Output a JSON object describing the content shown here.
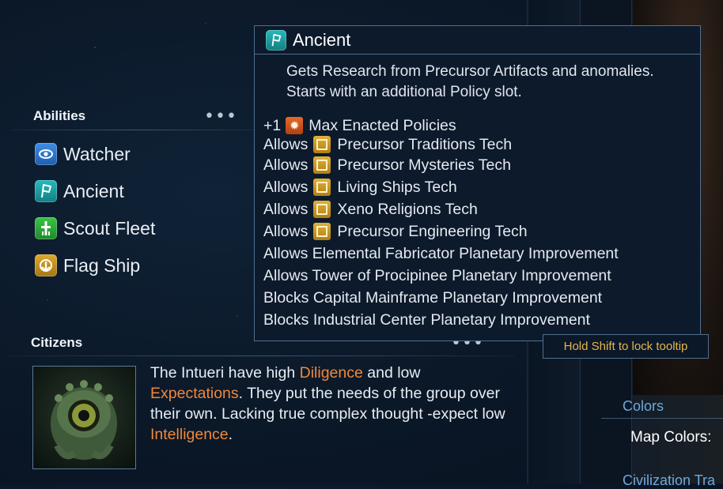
{
  "abilities": {
    "title": "Abilities",
    "more": "•••",
    "items": [
      {
        "label": "Watcher",
        "icon": "eye-icon",
        "color": "#2f7fd6"
      },
      {
        "label": "Ancient",
        "icon": "flag-icon",
        "color": "#1ea3a6"
      },
      {
        "label": "Scout Fleet",
        "icon": "scout-ship-icon",
        "color": "#2fae3a"
      },
      {
        "label": "Flag Ship",
        "icon": "flag-ship-icon",
        "color": "#c9951f"
      }
    ]
  },
  "tooltip": {
    "title": "Ancient",
    "description": "Gets Research from Precursor Artifacts and anomalies. Starts with an additional Policy slot.",
    "policy": {
      "prefix": "+1",
      "text": "Max Enacted Policies"
    },
    "allows_label": "Allows",
    "tech_lines": [
      "Precursor Traditions Tech",
      "Precursor Mysteries Tech",
      "Living Ships Tech",
      "Xeno Religions Tech",
      "Precursor Engineering Tech"
    ],
    "plain_lines": [
      "Allows Elemental Fabricator Planetary Improvement",
      "Allows Tower of Procipinee Planetary Improvement",
      "Blocks Capital Mainframe Planetary Improvement",
      "Blocks Industrial Center Planetary Improvement"
    ],
    "lock_hint": "Hold Shift to lock tooltip"
  },
  "citizens": {
    "title": "Citizens",
    "more": "•••",
    "text_parts": [
      "The Intueri have high ",
      "Diligence",
      " and low ",
      "Expectations",
      ". They put the needs of the group over their own. Lacking true complex thought -expect low ",
      "Intelligence",
      "."
    ]
  },
  "side": {
    "colors_title": "Colors",
    "map_colors_label": "Map Colors:",
    "civ_traits_label": "Civilization Tra"
  },
  "colors": {
    "highlight": "#f0883a",
    "accent_blue": "#6fa8dc",
    "hint_gold": "#e7b64a"
  }
}
